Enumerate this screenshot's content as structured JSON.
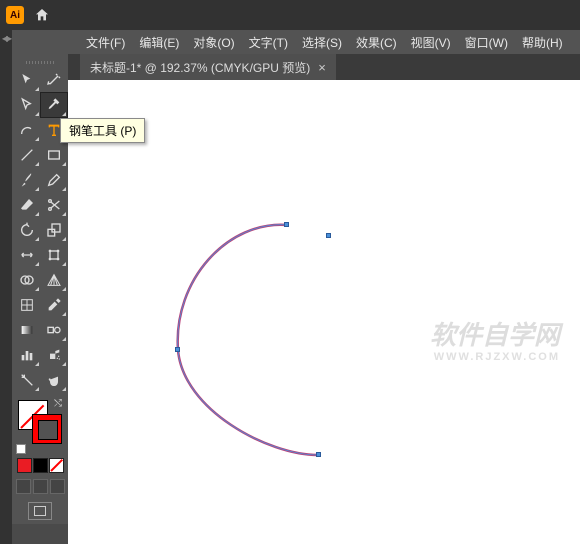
{
  "app": {
    "logo_text": "Ai"
  },
  "menu": {
    "file": "文件(F)",
    "edit": "编辑(E)",
    "object": "对象(O)",
    "type": "文字(T)",
    "select": "选择(S)",
    "effect": "效果(C)",
    "view": "视图(V)",
    "window": "窗口(W)",
    "help": "帮助(H)"
  },
  "tab": {
    "title": "未标题-1* @ 192.37% (CMYK/GPU 预览)",
    "close": "×"
  },
  "tooltip": {
    "pen": "钢笔工具 (P)"
  },
  "watermark": {
    "main": "软件自学网",
    "sub": "WWW.RJZXW.COM"
  },
  "colors": {
    "swatch1": "#ea1c24",
    "swatch2": "#000000",
    "swatch3_none": true
  }
}
